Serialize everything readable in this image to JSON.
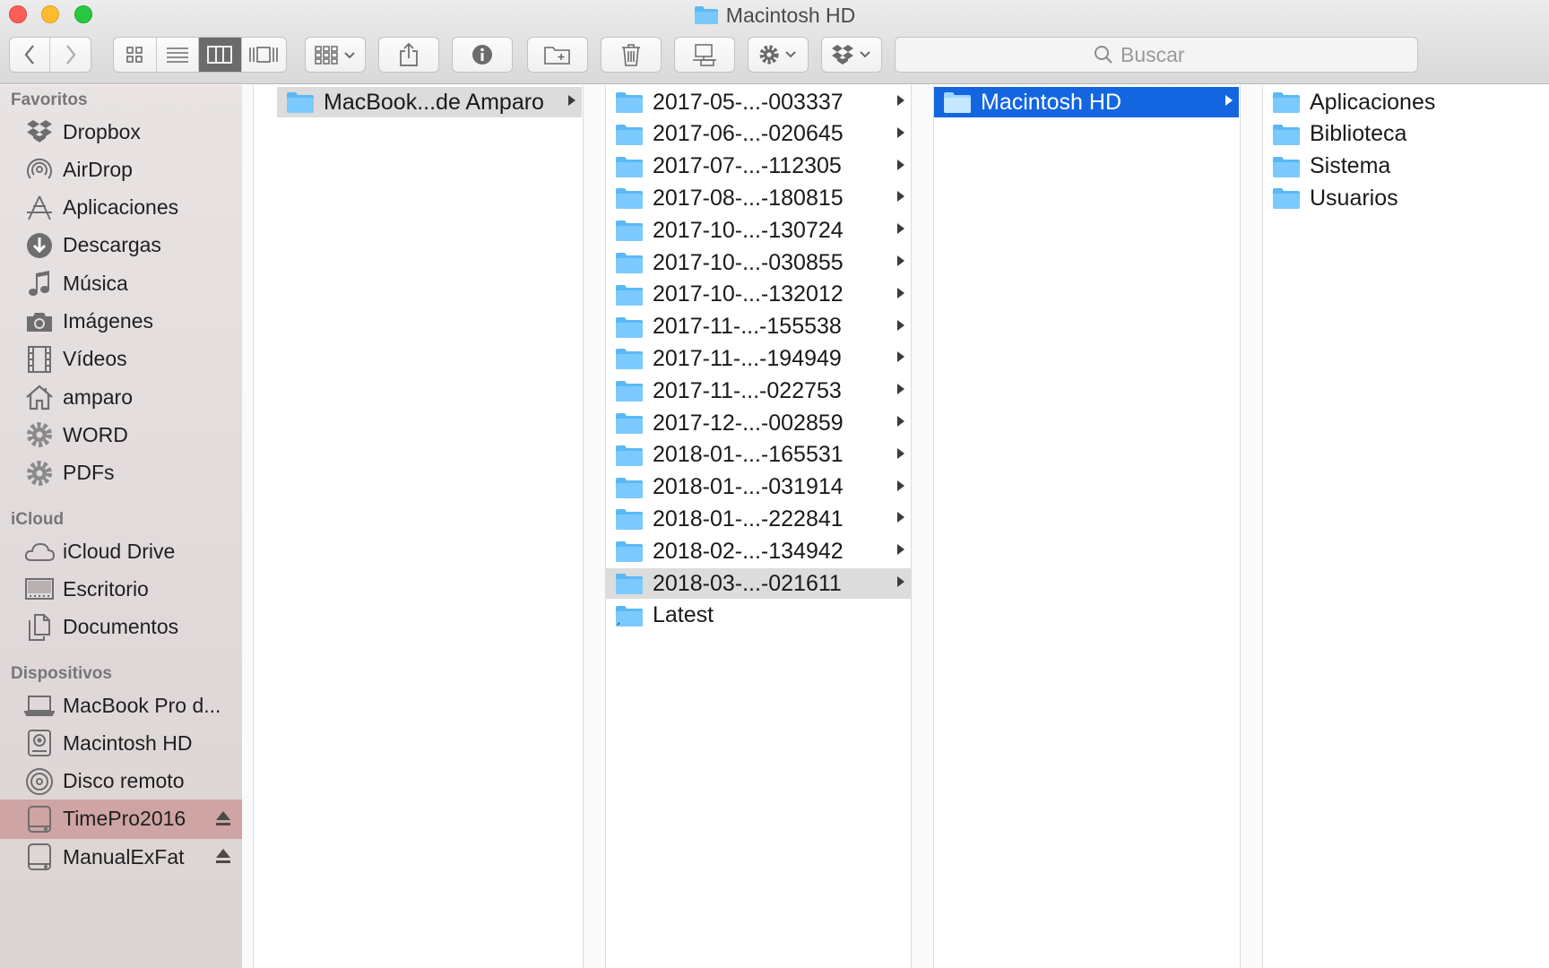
{
  "window": {
    "title": "Macintosh HD"
  },
  "toolbar": {
    "back": "back-icon",
    "forward": "forward-icon",
    "view_modes": [
      "icon-view-icon",
      "list-view-icon",
      "column-view-icon",
      "cover-flow-icon"
    ],
    "active_view": "column",
    "search_placeholder": "Buscar"
  },
  "sidebar": {
    "sections": [
      {
        "title": "Favoritos",
        "items": [
          {
            "label": "Dropbox",
            "icon": "dropbox-icon"
          },
          {
            "label": "AirDrop",
            "icon": "airdrop-icon"
          },
          {
            "label": "Aplicaciones",
            "icon": "applications-icon"
          },
          {
            "label": "Descargas",
            "icon": "downloads-icon"
          },
          {
            "label": "Música",
            "icon": "music-icon"
          },
          {
            "label": "Imágenes",
            "icon": "camera-icon"
          },
          {
            "label": "Vídeos",
            "icon": "film-icon"
          },
          {
            "label": "amparo",
            "icon": "home-icon"
          },
          {
            "label": "WORD",
            "icon": "gear-folder-icon"
          },
          {
            "label": "PDFs",
            "icon": "gear-folder-icon"
          }
        ]
      },
      {
        "title": "iCloud",
        "items": [
          {
            "label": "iCloud Drive",
            "icon": "cloud-icon"
          },
          {
            "label": "Escritorio",
            "icon": "desktop-icon"
          },
          {
            "label": "Documentos",
            "icon": "documents-icon"
          }
        ]
      },
      {
        "title": "Dispositivos",
        "items": [
          {
            "label": "MacBook Pro d...",
            "icon": "laptop-icon"
          },
          {
            "label": "Macintosh HD",
            "icon": "harddisk-icon"
          },
          {
            "label": "Disco remoto",
            "icon": "disc-icon"
          },
          {
            "label": "TimePro2016",
            "icon": "drive-icon",
            "eject": true,
            "selected": true
          },
          {
            "label": "ManualExFat",
            "icon": "drive-icon",
            "eject": true
          }
        ]
      }
    ]
  },
  "columns": [
    {
      "items": [
        {
          "label": "MacBook...de Amparo",
          "has_children": true,
          "state": "grey"
        }
      ]
    },
    {
      "items": [
        {
          "label": "2017-05-...-003337",
          "has_children": true
        },
        {
          "label": "2017-06-...-020645",
          "has_children": true
        },
        {
          "label": "2017-07-...-112305",
          "has_children": true
        },
        {
          "label": "2017-08-...-180815",
          "has_children": true
        },
        {
          "label": "2017-10-...-130724",
          "has_children": true
        },
        {
          "label": "2017-10-...-030855",
          "has_children": true
        },
        {
          "label": "2017-10-...-132012",
          "has_children": true
        },
        {
          "label": "2017-11-...-155538",
          "has_children": true
        },
        {
          "label": "2017-11-...-194949",
          "has_children": true
        },
        {
          "label": "2017-11-...-022753",
          "has_children": true
        },
        {
          "label": "2017-12-...-002859",
          "has_children": true
        },
        {
          "label": "2018-01-...-165531",
          "has_children": true
        },
        {
          "label": "2018-01-...-031914",
          "has_children": true
        },
        {
          "label": "2018-01-...-222841",
          "has_children": true
        },
        {
          "label": "2018-02-...-134942",
          "has_children": true
        },
        {
          "label": "2018-03-...-021611",
          "has_children": true,
          "state": "grey"
        },
        {
          "label": "Latest",
          "has_children": false,
          "alias": true
        }
      ]
    },
    {
      "items": [
        {
          "label": "Macintosh HD",
          "has_children": true,
          "state": "blue"
        }
      ]
    },
    {
      "items": [
        {
          "label": "Aplicaciones",
          "has_children": false
        },
        {
          "label": "Biblioteca",
          "has_children": false
        },
        {
          "label": "Sistema",
          "has_children": false
        },
        {
          "label": "Usuarios",
          "has_children": false
        }
      ]
    }
  ],
  "colors": {
    "selection_blue": "#1466e0",
    "folder_blue": "#5cb8f5",
    "sidebar_selected": "#cfa4a4"
  }
}
